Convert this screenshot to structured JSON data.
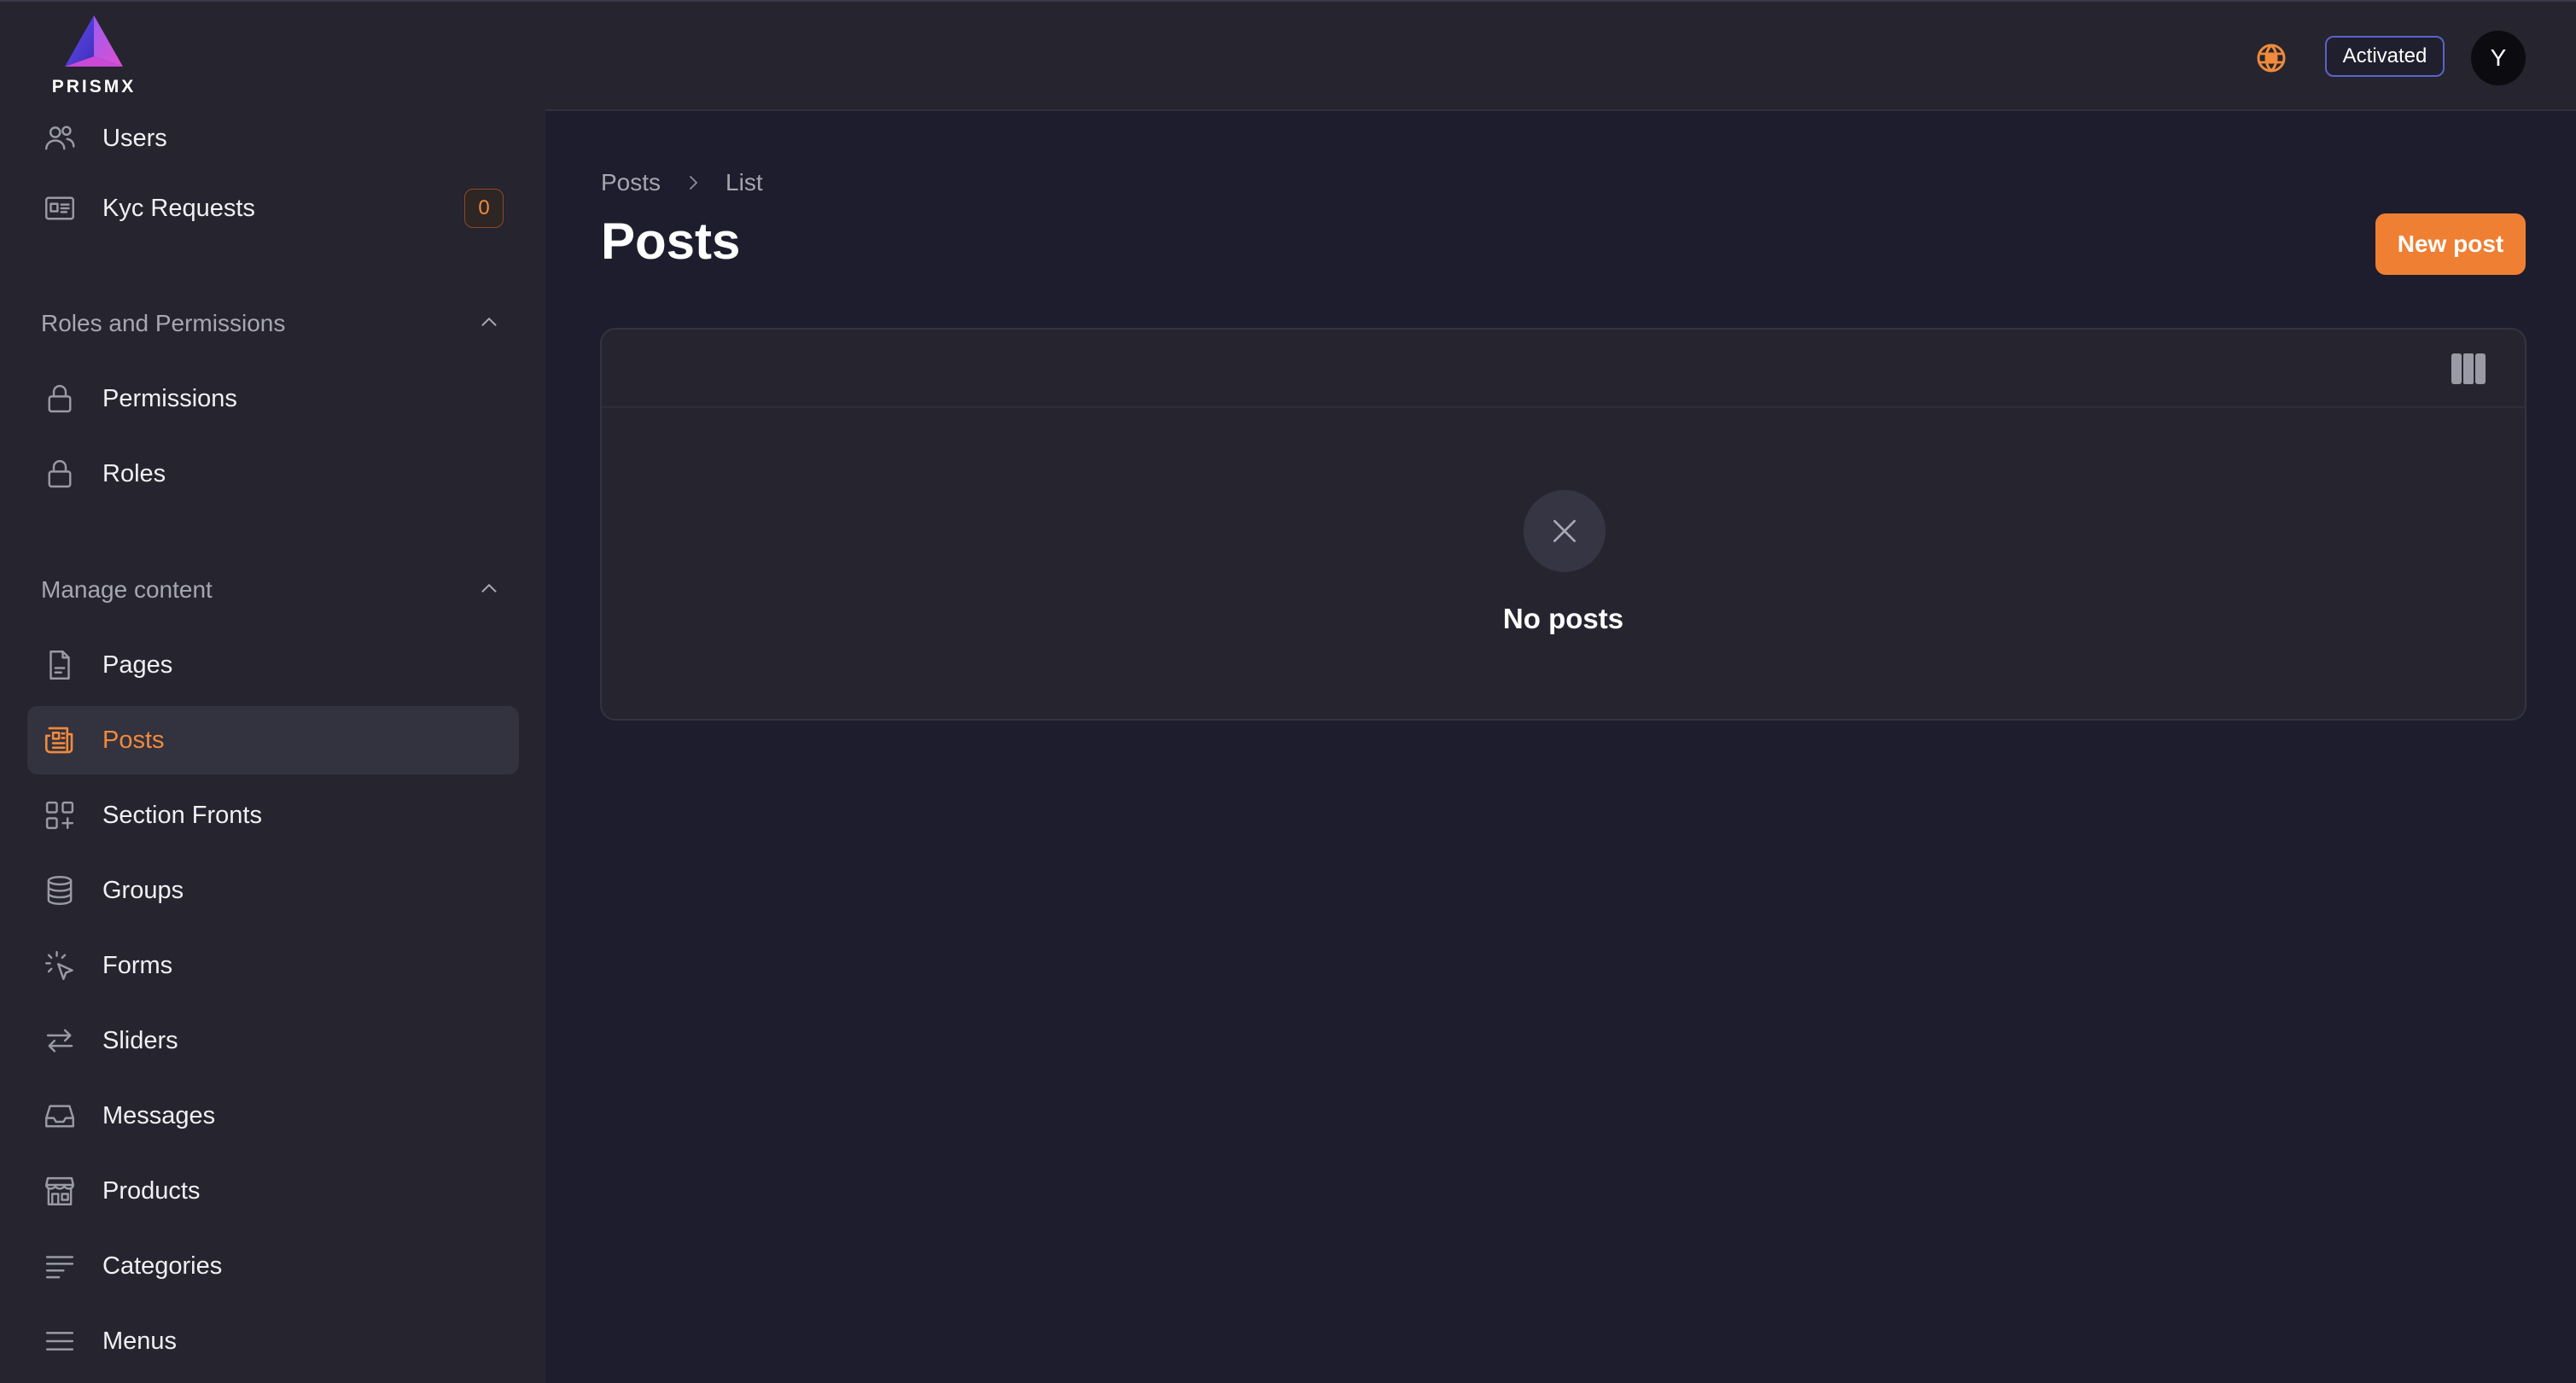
{
  "brand": {
    "name": "PRISMX"
  },
  "sidebar": {
    "top_items": [
      {
        "label": "Users",
        "icon": "users-icon"
      },
      {
        "label": "Kyc Requests",
        "icon": "id-card-icon",
        "badge": "0"
      }
    ],
    "groups": [
      {
        "title": "Roles and Permissions",
        "items": [
          {
            "label": "Permissions",
            "icon": "lock-icon"
          },
          {
            "label": "Roles",
            "icon": "lock-icon"
          }
        ]
      },
      {
        "title": "Manage content",
        "items": [
          {
            "label": "Pages",
            "icon": "document-icon"
          },
          {
            "label": "Posts",
            "icon": "newspaper-icon",
            "active": true
          },
          {
            "label": "Section Fronts",
            "icon": "grid-plus-icon"
          },
          {
            "label": "Groups",
            "icon": "database-icon"
          },
          {
            "label": "Forms",
            "icon": "cursor-click-icon"
          },
          {
            "label": "Sliders",
            "icon": "arrows-right-left-icon"
          },
          {
            "label": "Messages",
            "icon": "inbox-icon"
          },
          {
            "label": "Products",
            "icon": "storefront-icon"
          },
          {
            "label": "Categories",
            "icon": "bars-descending-icon"
          },
          {
            "label": "Menus",
            "icon": "bars-icon"
          }
        ]
      }
    ]
  },
  "topbar": {
    "status_label": "Activated",
    "avatar_initial": "Y",
    "language_icon": "globe-icon"
  },
  "main": {
    "breadcrumb": [
      "Posts",
      "List"
    ],
    "title": "Posts",
    "new_button_label": "New post",
    "empty_state_text": "No posts"
  },
  "colors": {
    "accent": "#ef7f32",
    "background": "#1e1d2d",
    "sidebar": "#25242f",
    "status_border": "#5a63c8"
  }
}
